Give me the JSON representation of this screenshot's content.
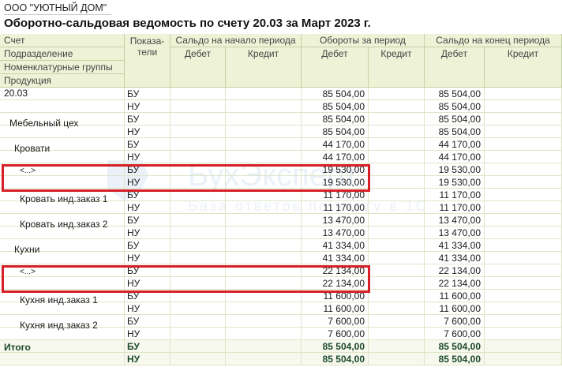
{
  "org": "ООО \"УЮТНЫЙ ДОМ\"",
  "title": "Оборотно-сальдовая ведомость по счету 20.03 за Март 2023 г.",
  "header": {
    "left": [
      "Счет",
      "Подразделение",
      "Номенклатурные группы",
      "Продукция"
    ],
    "indicators": "Показа-\nтели",
    "groups": [
      "Сальдо на начало периода",
      "Обороты за период",
      "Сальдо на конец периода"
    ],
    "debit": "Дебет",
    "credit": "Кредит"
  },
  "rows": [
    {
      "name": "20.03",
      "ind": "БУ",
      "ob_d": "85 504,00",
      "end_d": "85 504,00"
    },
    {
      "name": "",
      "ind": "НУ",
      "ob_d": "85 504,00",
      "end_d": "85 504,00"
    },
    {
      "name": "Мебельный цех",
      "ind": "БУ",
      "ob_d": "85 504,00",
      "end_d": "85 504,00"
    },
    {
      "name": "",
      "ind": "НУ",
      "ob_d": "85 504,00",
      "end_d": "85 504,00"
    },
    {
      "name": "Кровати",
      "ind": "БУ",
      "ob_d": "44 170,00",
      "end_d": "44 170,00"
    },
    {
      "name": "",
      "ind": "НУ",
      "ob_d": "44 170,00",
      "end_d": "44 170,00"
    },
    {
      "name": "<...>",
      "ind": "БУ",
      "ob_d": "19 530,00",
      "end_d": "19 530,00"
    },
    {
      "name": "",
      "ind": "НУ",
      "ob_d": "19 530,00",
      "end_d": "19 530,00"
    },
    {
      "name": "Кровать инд.заказ 1",
      "ind": "БУ",
      "ob_d": "11 170,00",
      "end_d": "11 170,00"
    },
    {
      "name": "",
      "ind": "НУ",
      "ob_d": "11 170,00",
      "end_d": "11 170,00"
    },
    {
      "name": "Кровать инд.заказ 2",
      "ind": "БУ",
      "ob_d": "13 470,00",
      "end_d": "13 470,00"
    },
    {
      "name": "",
      "ind": "НУ",
      "ob_d": "13 470,00",
      "end_d": "13 470,00"
    },
    {
      "name": "Кухни",
      "ind": "БУ",
      "ob_d": "41 334,00",
      "end_d": "41 334,00"
    },
    {
      "name": "",
      "ind": "НУ",
      "ob_d": "41 334,00",
      "end_d": "41 334,00"
    },
    {
      "name": "<...>",
      "ind": "БУ",
      "ob_d": "22 134,00",
      "end_d": "22 134,00"
    },
    {
      "name": "",
      "ind": "НУ",
      "ob_d": "22 134,00",
      "end_d": "22 134,00"
    },
    {
      "name": "Кухня инд.заказ 1",
      "ind": "БУ",
      "ob_d": "11 600,00",
      "end_d": "11 600,00"
    },
    {
      "name": "",
      "ind": "НУ",
      "ob_d": "11 600,00",
      "end_d": "11 600,00"
    },
    {
      "name": "Кухня инд.заказ 2",
      "ind": "БУ",
      "ob_d": "7 600,00",
      "end_d": "7 600,00"
    },
    {
      "name": "",
      "ind": "НУ",
      "ob_d": "7 600,00",
      "end_d": "7 600,00"
    }
  ],
  "total": {
    "label": "Итого",
    "rows": [
      {
        "ind": "БУ",
        "ob_d": "85 504,00",
        "end_d": "85 504,00"
      },
      {
        "ind": "НУ",
        "ob_d": "85 504,00",
        "end_d": "85 504,00"
      }
    ]
  },
  "watermark": {
    "brand": "БухЭксперт",
    "tagline": "База ответов по учету в 1С"
  },
  "colors": {
    "highlight": "#d61f26",
    "header_bg": "#eef3d7",
    "total_text": "#1c4a2a"
  }
}
